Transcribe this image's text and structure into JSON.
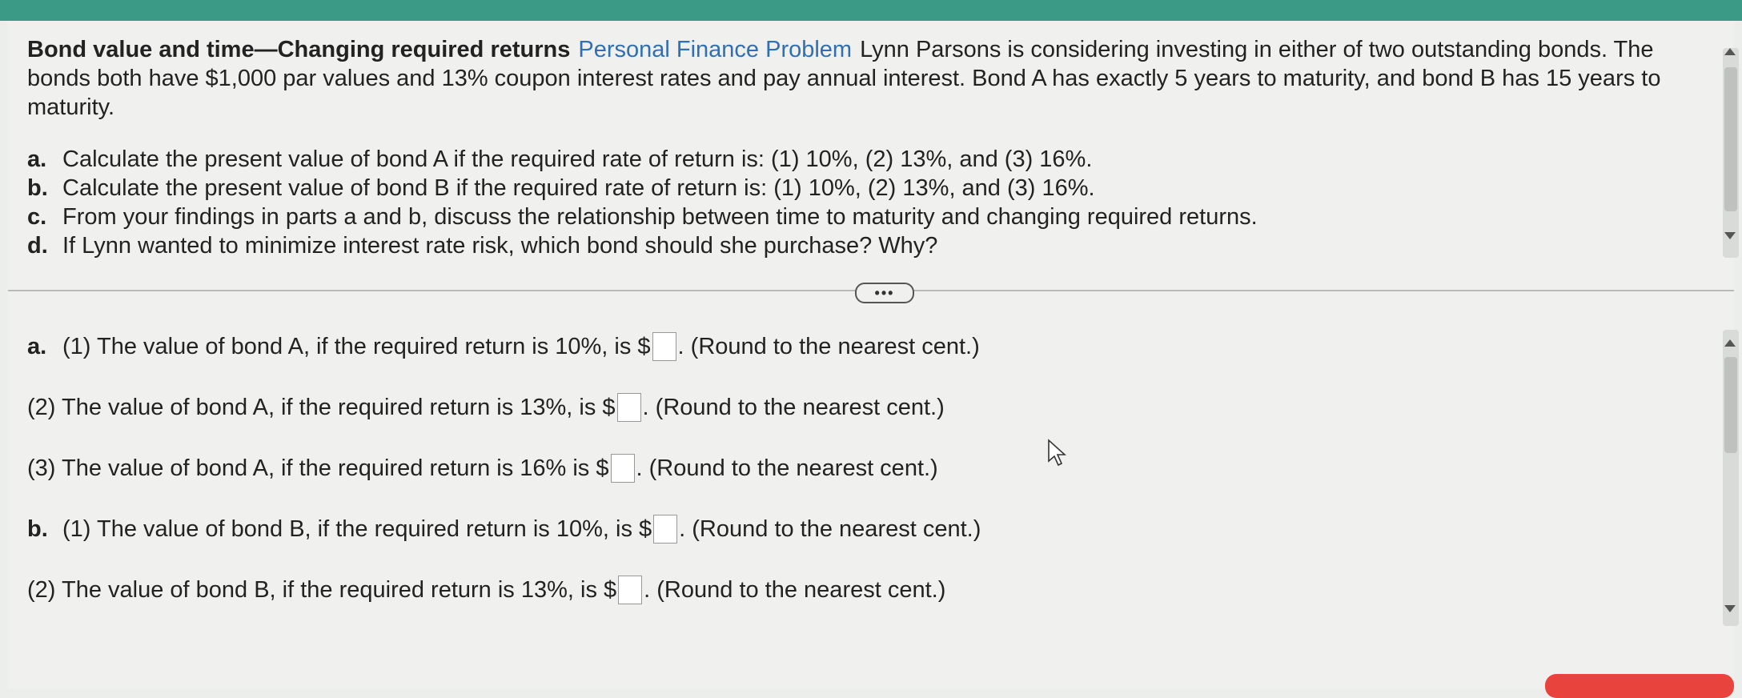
{
  "problem": {
    "title": "Bond value and time—Changing required returns",
    "tag": "Personal Finance Problem",
    "intro_lines": [
      "Lynn Parsons is considering investing in either of two outstanding bonds. The",
      "bonds both have $1,000 par values and 13% coupon interest rates and pay annual interest. Bond A has exactly 5 years to maturity, and bond B has 15 years to",
      "maturity."
    ]
  },
  "parts": [
    {
      "letter": "a.",
      "text": "Calculate the present value of bond A if the required rate of return is: (1) 10%, (2) 13%, and (3) 16%."
    },
    {
      "letter": "b.",
      "text": "Calculate the present value of bond B if the required rate of return is: (1) 10%, (2) 13%, and (3) 16%."
    },
    {
      "letter": "c.",
      "text": "From your findings in parts a and b, discuss the relationship between time to maturity and changing required returns."
    },
    {
      "letter": "d.",
      "text": "If Lynn wanted to minimize interest rate risk, which bond should she purchase? Why?"
    }
  ],
  "more_button": "•••",
  "answers": [
    {
      "lead": "a.",
      "prefix": "(1) The value of bond A, if the required return is 10%, is $",
      "value": "",
      "suffix": ". (Round to the nearest cent.)"
    },
    {
      "lead": "",
      "prefix": "(2) The value of bond A, if the required return is 13%, is $",
      "value": "",
      "suffix": ". (Round to the nearest cent.)"
    },
    {
      "lead": "",
      "prefix": "(3) The value of bond A, if the required return is 16% is $",
      "value": "",
      "suffix": ". (Round to the nearest cent.)"
    },
    {
      "lead": "b.",
      "prefix": "(1) The value of bond B, if the required return is 10%, is $",
      "value": "",
      "suffix": ". (Round to the nearest cent.)"
    },
    {
      "lead": "",
      "prefix": "(2) The value of bond B, if the required return is 13%, is $",
      "value": "",
      "suffix": ". (Round to the nearest cent.)"
    }
  ],
  "colors": {
    "topbar": "#3a9a86",
    "tag": "#2f6fb3",
    "bottom_pill": "#e8433c"
  },
  "icons": {
    "scroll_up": "chevron-up-icon",
    "scroll_down": "chevron-down-icon",
    "cursor": "mouse-pointer-icon"
  }
}
